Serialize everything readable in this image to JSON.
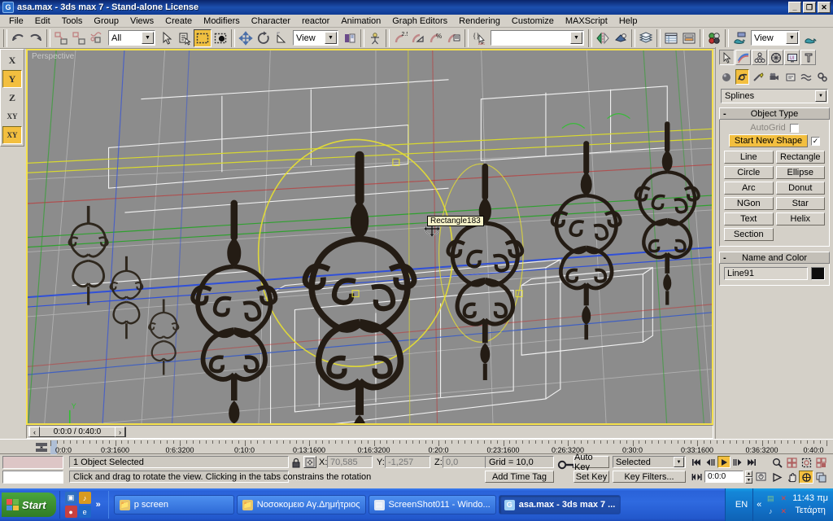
{
  "window": {
    "title": "asa.max - 3ds max 7  - Stand-alone License",
    "app_icon": "max-logo-icon",
    "minimize": "_",
    "restore": "❐",
    "close": "✕"
  },
  "menu": {
    "items": [
      "File",
      "Edit",
      "Tools",
      "Group",
      "Views",
      "Create",
      "Modifiers",
      "Character",
      "reactor",
      "Animation",
      "Graph Editors",
      "Rendering",
      "Customize",
      "MAXScript",
      "Help"
    ]
  },
  "toolbar": {
    "selection_filter": "All",
    "reference_coord_system": "View",
    "named_selection_set": "",
    "render_preset": "View",
    "buttons": [
      {
        "name": "undo-button",
        "label": "Undo"
      },
      {
        "name": "redo-button",
        "label": "Redo"
      },
      {
        "name": "select-and-link-button",
        "label": "Select and Link"
      },
      {
        "name": "unlink-selection-button",
        "label": "Unlink Selection"
      },
      {
        "name": "bind-to-space-warp-button",
        "label": "Bind to Space Warp"
      },
      {
        "name": "select-object-button",
        "label": "Select Object"
      },
      {
        "name": "select-by-name-button",
        "label": "Select by Name"
      },
      {
        "name": "select-region-button",
        "label": "Rectangular Selection Region"
      },
      {
        "name": "window-crossing-button",
        "label": "Window / Crossing"
      },
      {
        "name": "select-and-move-button",
        "label": "Select and Move"
      },
      {
        "name": "select-and-rotate-button",
        "label": "Select and Rotate"
      },
      {
        "name": "select-and-scale-button",
        "label": "Select and Uniform Scale"
      },
      {
        "name": "mirror-button",
        "label": "Mirror"
      },
      {
        "name": "align-button",
        "label": "Align"
      },
      {
        "name": "layer-manager-button",
        "label": "Layer Manager"
      },
      {
        "name": "curve-editor-button",
        "label": "Curve Editor"
      },
      {
        "name": "schematic-view-button",
        "label": "Schematic View"
      },
      {
        "name": "material-editor-button",
        "label": "Material Editor"
      },
      {
        "name": "render-scene-button",
        "label": "Render Scene Dialog"
      },
      {
        "name": "quick-render-button",
        "label": "Quick Render"
      }
    ],
    "snap_labels": {
      "percent": "%",
      "angle": "2.5"
    }
  },
  "axis_toolbar": {
    "items": [
      {
        "label": "X",
        "active": false
      },
      {
        "label": "Y",
        "active": true
      },
      {
        "label": "Z",
        "active": false
      },
      {
        "label": "XY",
        "active": false
      },
      {
        "label": "XY",
        "active": true
      }
    ]
  },
  "viewport": {
    "label": "Perspective",
    "tooltip": "Rectangle183",
    "background_color": "#8c8c8c",
    "active_border_color": "#f4e04d",
    "axis_tripod": {
      "x": "X",
      "y": "Y",
      "z": "Z"
    }
  },
  "command_panel": {
    "tabs": [
      {
        "name": "create-tab",
        "icon": "arrow-cursor-icon",
        "active": true
      },
      {
        "name": "modify-tab",
        "icon": "rainbow-arc-icon",
        "active": false
      },
      {
        "name": "hierarchy-tab",
        "icon": "hierarchy-tree-icon",
        "active": false
      },
      {
        "name": "motion-tab",
        "icon": "wheel-icon",
        "active": false
      },
      {
        "name": "display-tab",
        "icon": "monitor-icon",
        "active": false
      },
      {
        "name": "utilities-tab",
        "icon": "hammer-icon",
        "active": false
      }
    ],
    "categories": [
      {
        "name": "geometry-category",
        "icon": "sphere-icon",
        "active": false
      },
      {
        "name": "shapes-category",
        "icon": "spline-icon",
        "active": true
      },
      {
        "name": "lights-category",
        "icon": "light-icon",
        "active": false
      },
      {
        "name": "cameras-category",
        "icon": "camera-icon",
        "active": false
      },
      {
        "name": "helpers-category",
        "icon": "helper-icon",
        "active": false
      },
      {
        "name": "space-warps-category",
        "icon": "wave-icon",
        "active": false
      },
      {
        "name": "systems-category",
        "icon": "gears-icon",
        "active": false
      }
    ],
    "subcategory": "Splines",
    "object_type": {
      "header": "Object Type",
      "autogrid_label": "AutoGrid",
      "autogrid_checked": false,
      "start_new_shape_label": "Start New Shape",
      "start_new_shape_checked": true,
      "buttons": [
        "Line",
        "Rectangle",
        "Circle",
        "Ellipse",
        "Arc",
        "Donut",
        "NGon",
        "Star",
        "Text",
        "Helix",
        "Section"
      ]
    },
    "name_and_color": {
      "header": "Name and Color",
      "object_name": "Line91",
      "color": "#0d0d0d"
    }
  },
  "time_slider": {
    "current": "0:0:0 / 0:40:0",
    "prev_arrow": "‹",
    "next_arrow": "›"
  },
  "track_bar": {
    "ticks": [
      "0:0:0",
      "0:3:1600",
      "0:6:3200",
      "0:10:0",
      "0:13:1600",
      "0:16:3200",
      "0:20:0",
      "0:23:1600",
      "0:26:3200",
      "0:30:0",
      "0:33:1600",
      "0:36:3200",
      "0:40:0"
    ]
  },
  "status": {
    "selection": "1 Object Selected",
    "prompt": "Click and drag to rotate the view.  Clicking in the tabs constrains the rotation",
    "lock_icon": "padlock-icon",
    "absolute_mode_icon": "absolute-relative-icon",
    "coords": [
      {
        "label": "X:",
        "value": "70,585"
      },
      {
        "label": "Y:",
        "value": "-1,257"
      },
      {
        "label": "Z:",
        "value": "0,0"
      }
    ],
    "grid": "Grid = 10,0",
    "add_time_tag": "Add Time Tag",
    "key_mode_icon": "key-icon"
  },
  "animation": {
    "auto_key": "Auto Key",
    "set_key": "Set Key",
    "key_mode_selection": "Selected",
    "key_filters": "Key Filters...",
    "current_time": "0:0:0",
    "playback": [
      {
        "name": "goto-start-button",
        "glyph": "⏮"
      },
      {
        "name": "previous-frame-button",
        "glyph": "◂‖"
      },
      {
        "name": "play-animation-button",
        "glyph": "▶"
      },
      {
        "name": "next-frame-button",
        "glyph": "‖▸"
      },
      {
        "name": "goto-end-button",
        "glyph": "⏭"
      },
      {
        "name": "key-mode-toggle-button",
        "glyph": "◂▸"
      }
    ]
  },
  "viewport_nav": {
    "buttons": [
      {
        "name": "zoom-button",
        "icon": "magnifier-icon",
        "active": false
      },
      {
        "name": "zoom-all-button",
        "icon": "zoom-all-icon",
        "active": false
      },
      {
        "name": "zoom-extents-button",
        "icon": "zoom-extents-icon",
        "active": false
      },
      {
        "name": "zoom-region-button",
        "icon": "zoom-region-icon",
        "active": false
      },
      {
        "name": "field-of-view-button",
        "icon": "field-of-view-icon",
        "active": false
      },
      {
        "name": "pan-button",
        "icon": "hand-icon",
        "active": false
      },
      {
        "name": "arc-rotate-button",
        "icon": "arc-rotate-icon",
        "active": true
      },
      {
        "name": "maximize-viewport-toggle",
        "icon": "maximize-viewport-icon",
        "active": false
      }
    ]
  },
  "taskbar": {
    "start_label": "Start",
    "quicklaunch": [
      {
        "name": "show-desktop-icon",
        "glyph": "▣",
        "color": "#2f6fc0"
      },
      {
        "name": "media-player-icon",
        "glyph": "♪",
        "color": "#d89a20"
      },
      {
        "name": "messenger-icon",
        "glyph": "●",
        "color": "#c84040"
      },
      {
        "name": "browser-icon",
        "glyph": "e",
        "color": "#1e68c8"
      }
    ],
    "chevron": "»",
    "tasks": [
      {
        "label": "p screen",
        "icon": "folder-icon",
        "icon_color": "#e8c76a",
        "active": false
      },
      {
        "label": "Νοσοκομειο Αγ.Δημήτριος",
        "icon": "folder-icon",
        "icon_color": "#e8c76a",
        "active": false
      },
      {
        "label": "ScreenShot011 - Windo...",
        "icon": "image-viewer-icon",
        "icon_color": "#dfe8f4",
        "active": false
      },
      {
        "label": "asa.max - 3ds max 7  ...",
        "icon": "max-logo-icon",
        "icon_color": "#9fd0f4",
        "active": true
      }
    ],
    "tray": {
      "language": "EN",
      "chevron": "«",
      "icons": [
        {
          "name": "network-icon",
          "glyph": "▤",
          "color": "#7fc48a"
        },
        {
          "name": "network-disconnected-icon",
          "glyph": "✕",
          "color": "#e04040"
        },
        {
          "name": "volume-icon",
          "glyph": "♪",
          "color": "#cfe4f4"
        },
        {
          "name": "volume-muted-icon",
          "glyph": "✕",
          "color": "#e04040"
        }
      ],
      "time": "11:43 πμ",
      "day": "Τετάρτη"
    }
  }
}
